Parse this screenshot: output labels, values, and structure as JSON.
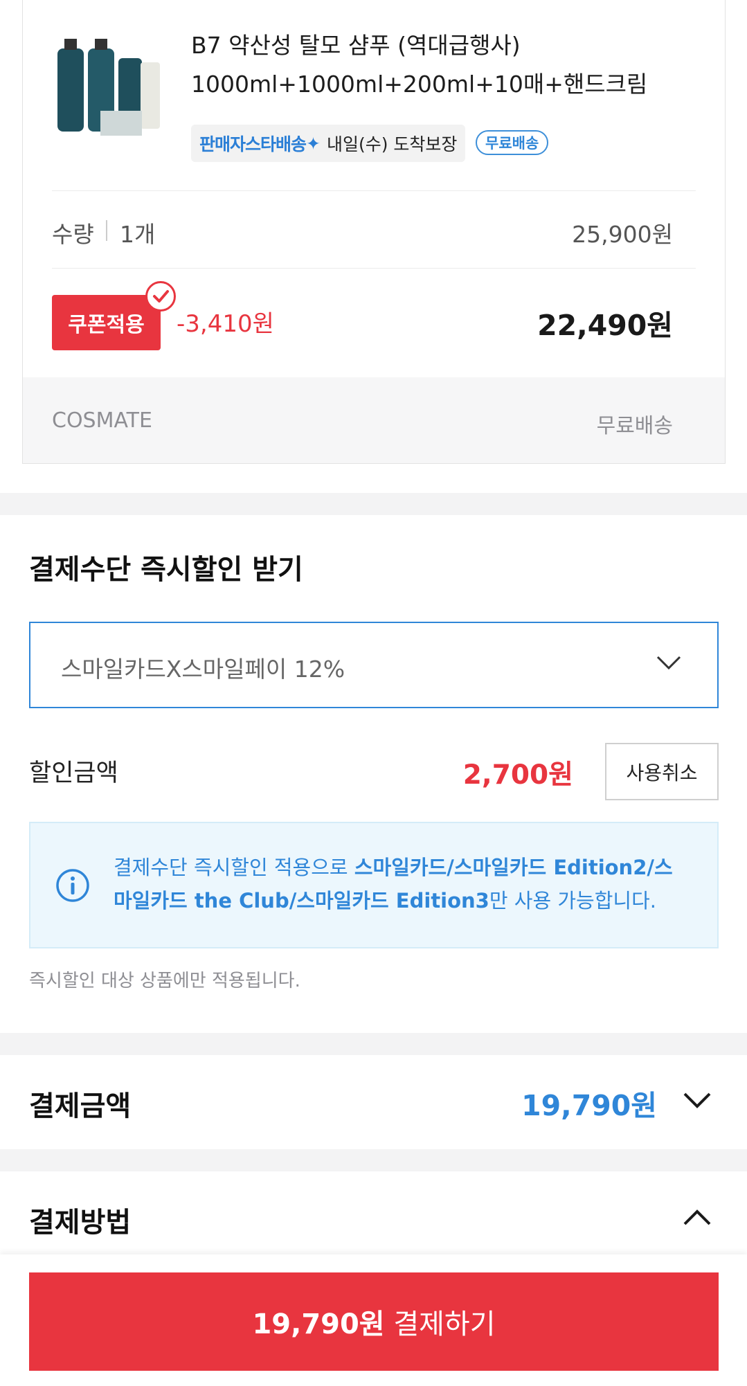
{
  "product": {
    "title": "B7 약산성 탈모 샴푸 (역대급행사) 1000ml+1000ml+200ml+10매+핸드크림",
    "delivery_brand": "판매자스타배송",
    "arrival": "내일(수) 도착보장",
    "free_badge": "무료배송",
    "quantity_label": "수량",
    "quantity_value": "1개",
    "original_price": "25,900원",
    "coupon_badge": "쿠폰적용",
    "coupon_discount": "-3,410원",
    "final_price": "22,490원",
    "seller": "COSMATE",
    "shipping": "무료배송"
  },
  "instant_discount": {
    "title": "결제수단 즉시할인 받기",
    "selected": "스마일카드X스마일페이 12%",
    "amount_label": "할인금액",
    "amount": "2,700원",
    "cancel_label": "사용취소",
    "info_prefix": "결제수단 즉시할인 적용으로 ",
    "info_cards": "스마일카드/스마일카드 Edition2/스마일카드 the Club/스마일카드 Edition3",
    "info_suffix": "만 사용 가능합니다.",
    "note": "즉시할인 대상 상품에만 적용됩니다."
  },
  "payment_total": {
    "label": "결제금액",
    "amount": "19,790원"
  },
  "payment_method": {
    "label": "결제방법"
  },
  "pay_button": {
    "amount": "19,790원",
    "action": " 결제하기"
  },
  "colors": {
    "accent_red": "#e8353f",
    "accent_blue": "#2f86d8"
  }
}
